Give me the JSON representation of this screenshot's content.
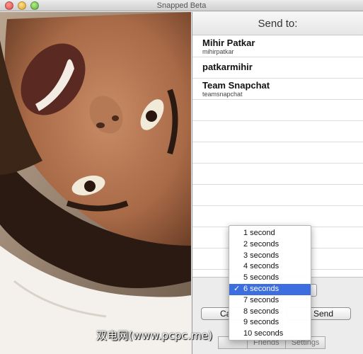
{
  "window": {
    "title": "Snapped Beta"
  },
  "send_to": {
    "header": "Send to:",
    "contacts": [
      {
        "name": "Mihir Patkar",
        "username": "mihirpatkar"
      },
      {
        "name": "patkarmihir",
        "username": ""
      },
      {
        "name": "Team Snapchat",
        "username": "teamsnapchat"
      }
    ]
  },
  "buttons": {
    "cancel": "Ca",
    "send": "Send"
  },
  "tabs": [
    "",
    "Friends",
    "Settings"
  ],
  "timer_menu": {
    "items": [
      "1 second",
      "2 seconds",
      "3 seconds",
      "4 seconds",
      "5 seconds",
      "6 seconds",
      "7 seconds",
      "8 seconds",
      "9 seconds",
      "10 seconds"
    ],
    "selected_index": 5,
    "check_glyph": "✓"
  },
  "watermark": "双电网(www.pcpc.me)",
  "colors": {
    "menu_highlight": "#3c6ee0"
  }
}
